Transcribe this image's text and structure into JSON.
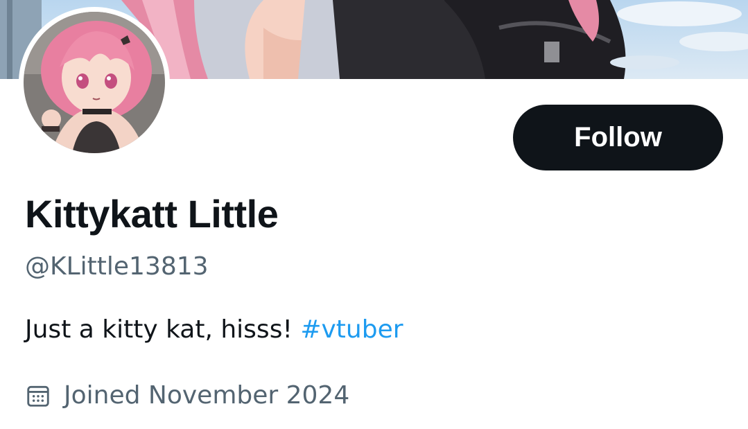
{
  "profile": {
    "display_name": "Kittykatt Little",
    "handle": "@KLittle13813",
    "bio_text": "Just a kitty kat, hisss! ",
    "bio_hashtag": "#vtuber",
    "joined": "Joined November 2024"
  },
  "actions": {
    "follow_label": "Follow"
  },
  "icons": {
    "joined": "calendar-icon"
  },
  "colors": {
    "button_bg": "#0f1419",
    "text_primary": "#0f1419",
    "text_secondary": "#536471",
    "link": "#1d9bf0"
  }
}
